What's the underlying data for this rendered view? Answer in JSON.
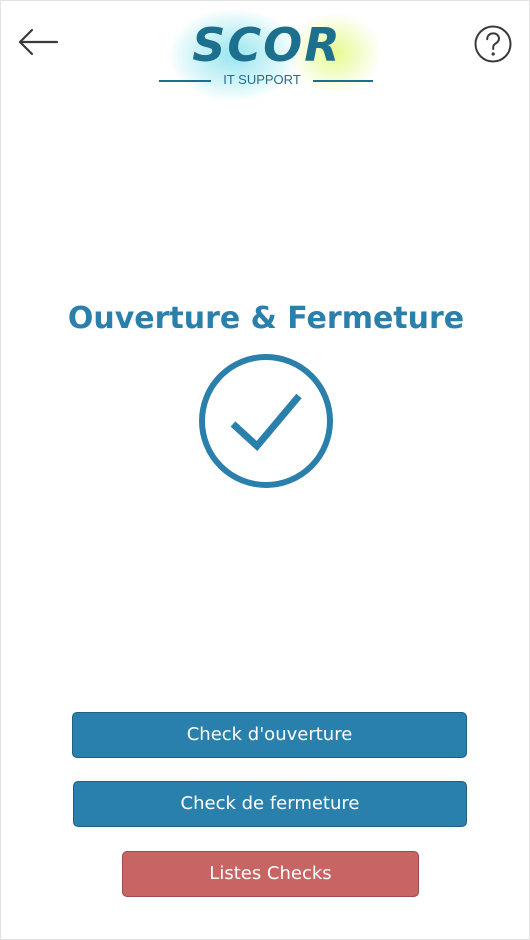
{
  "header": {
    "back_icon": "arrow-left-icon",
    "help_icon": "question-circle-icon",
    "logo": {
      "brand": "SCOR",
      "subtitle": "IT SUPPORT"
    }
  },
  "main": {
    "title": "Ouverture & Fermeture",
    "status_icon": "check-circle-icon"
  },
  "actions": {
    "open_check_label": "Check d'ouverture",
    "close_check_label": "Check de fermeture",
    "list_checks_label": "Listes Checks"
  },
  "colors": {
    "primary": "#2a80ad",
    "title": "#2a7fab",
    "danger": "#c66563",
    "icon_dark": "#3a3a3a"
  }
}
